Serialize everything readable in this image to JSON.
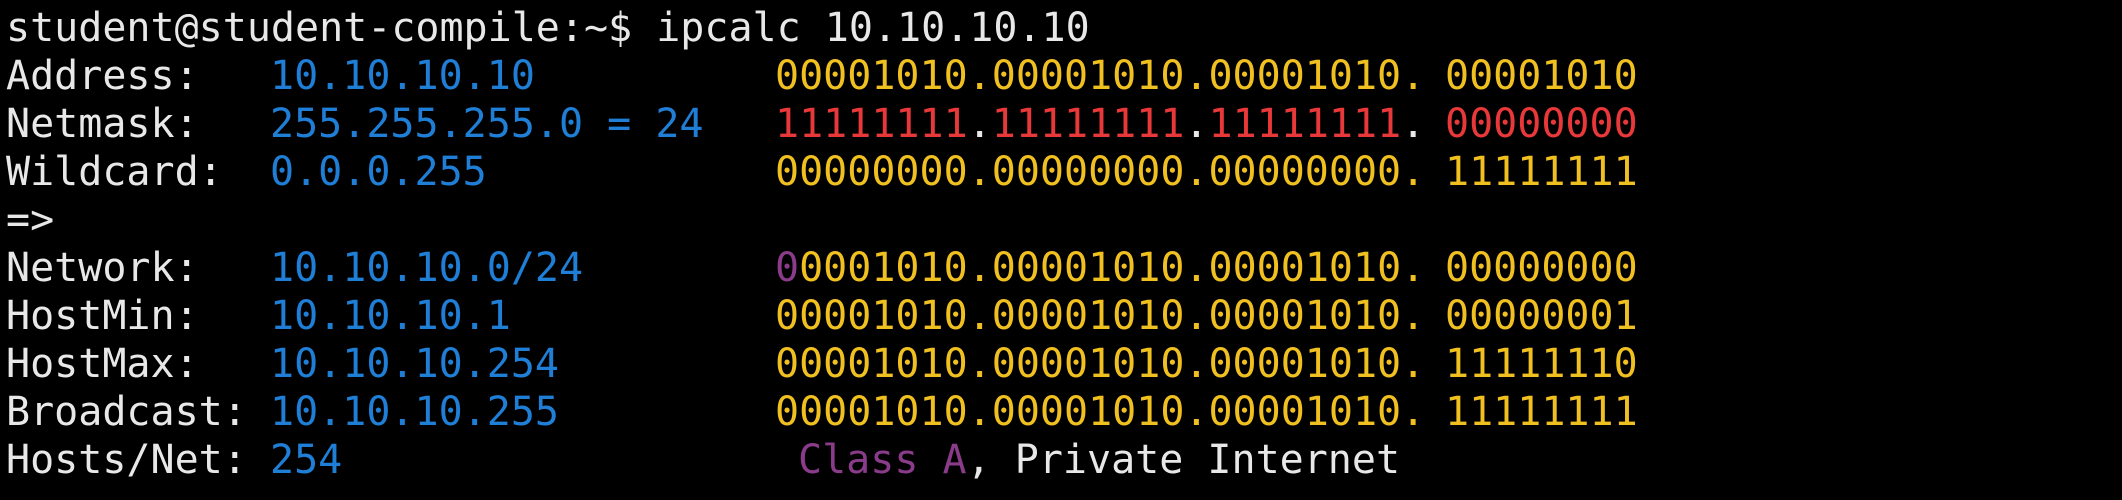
{
  "prompt": {
    "user_host": "student@student-compile:~$ ",
    "command": "ipcalc 10.10.10.10"
  },
  "colors": {
    "background": "#000000",
    "text": "#e8e8e8",
    "value": "#1f7fd6",
    "binary": "#f0c020",
    "netmask_binary": "#e8383a",
    "class_bit": "#8a3c8a"
  },
  "rows": {
    "address": {
      "label": "Address:",
      "value": "10.10.10.10",
      "bin_first": "00001010.00001010.00001010.",
      "bin_last": "00001010"
    },
    "netmask": {
      "label": "Netmask:",
      "value": "255.255.255.0 = 24",
      "bin_octet1": "11111111",
      "bin_octet2": "11111111",
      "bin_octet3": "11111111",
      "bin_last": "00000000"
    },
    "wildcard": {
      "label": "Wildcard:",
      "value": "0.0.0.255",
      "bin_first": "00000000.00000000.00000000.",
      "bin_last": "11111111"
    },
    "arrow": "=>",
    "network": {
      "label": "Network:",
      "value": "10.10.10.0/24",
      "class_bit": "0",
      "bin_first_rest": "0001010.00001010.00001010.",
      "bin_last": "00000000"
    },
    "hostmin": {
      "label": "HostMin:",
      "value": "10.10.10.1",
      "bin_first": "00001010.00001010.00001010.",
      "bin_last": "00000001"
    },
    "hostmax": {
      "label": "HostMax:",
      "value": "10.10.10.254",
      "bin_first": "00001010.00001010.00001010.",
      "bin_last": "11111110"
    },
    "broadcast": {
      "label": "Broadcast:",
      "value": "10.10.10.255",
      "bin_first": "00001010.00001010.00001010.",
      "bin_last": "11111111"
    },
    "hosts": {
      "label": "Hosts/Net:",
      "value": "254",
      "class_label": "Class A",
      "network_type": ", Private Internet"
    }
  }
}
